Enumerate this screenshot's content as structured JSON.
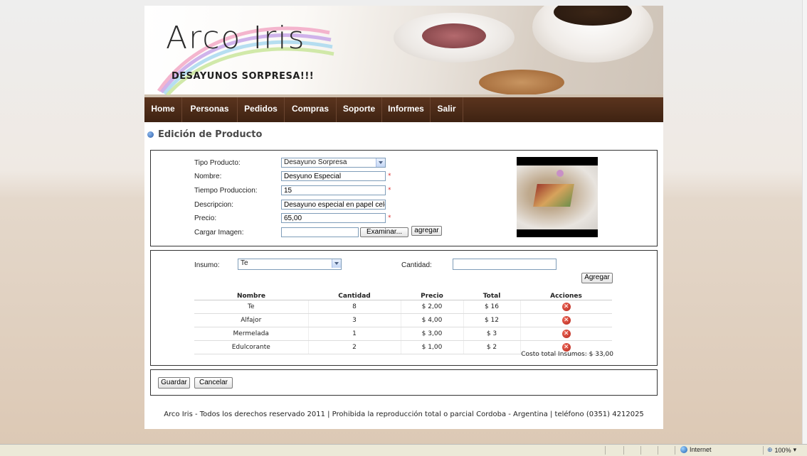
{
  "header": {
    "logo_title": "Arco Iris",
    "logo_subtitle": "DESAYUNOS SORPRESA!!!"
  },
  "nav": {
    "items": [
      "Home",
      "Personas",
      "Pedidos",
      "Compras",
      "Soporte",
      "Informes",
      "Salir"
    ]
  },
  "page_title": "Edición de Producto",
  "product_form": {
    "tipo_label": "Tipo Producto:",
    "tipo_value": "Desayuno Sorpresa",
    "nombre_label": "Nombre:",
    "nombre_value": "Desyuno Especial",
    "tiempo_label": "Tiempo Produccion:",
    "tiempo_value": "15",
    "descripcion_label": "Descripcion:",
    "descripcion_value": "Desayuno especial en papel celofan",
    "precio_label": "Precio:",
    "precio_value": "65,00",
    "imagen_label": "Cargar Imagen:",
    "imagen_value": "",
    "required_mark": "*",
    "browse_button": "Examinar...",
    "add_image_button": "agregar"
  },
  "insumos": {
    "insumo_label": "Insumo:",
    "insumo_value": "Te",
    "cantidad_label": "Cantidad:",
    "cantidad_value": "",
    "add_button": "Agregar",
    "columns": [
      "Nombre",
      "Cantidad",
      "Precio",
      "Total",
      "Acciones"
    ],
    "rows": [
      {
        "nombre": "Te",
        "cantidad": "8",
        "precio": "$ 2,00",
        "total": "$ 16"
      },
      {
        "nombre": "Alfajor",
        "cantidad": "3",
        "precio": "$ 4,00",
        "total": "$ 12"
      },
      {
        "nombre": "Mermelada",
        "cantidad": "1",
        "precio": "$ 3,00",
        "total": "$ 3"
      },
      {
        "nombre": "Edulcorante",
        "cantidad": "2",
        "precio": "$ 1,00",
        "total": "$ 2"
      }
    ],
    "total_text": "Costo total Insumos: $ 33,00"
  },
  "actions": {
    "save_button": "Guardar",
    "cancel_button": "Cancelar"
  },
  "footer": "Arco Iris - Todos los derechos reservado 2011 | Prohibida la reproducción total o parcial Cordoba - Argentina | teléfono (0351) 4212025",
  "statusbar": {
    "zone": "Internet",
    "zoom": "100%"
  }
}
